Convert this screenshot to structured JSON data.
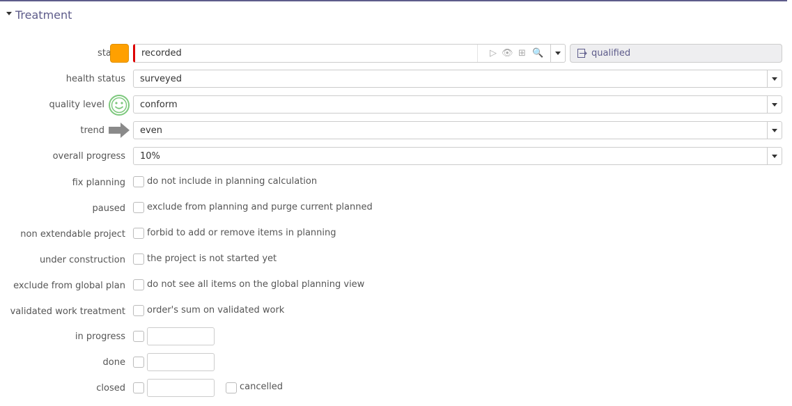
{
  "section": {
    "title": "Treatment"
  },
  "status": {
    "label": "status",
    "value": "recorded",
    "next_status": "qualified",
    "color": "#ffa000"
  },
  "health_status": {
    "label": "health status",
    "value": "surveyed"
  },
  "quality_level": {
    "label": "quality level",
    "value": "conform",
    "icon": "smiley-icon"
  },
  "trend": {
    "label": "trend",
    "value": "even",
    "icon": "arrow-right-icon"
  },
  "overall_progress": {
    "label": "overall progress",
    "value": "10%"
  },
  "fix_planning": {
    "label": "fix planning",
    "text": "do not include in planning calculation"
  },
  "paused": {
    "label": "paused",
    "text": "exclude from planning and purge current planned"
  },
  "non_extendable": {
    "label": "non extendable project",
    "text": "forbid to add or remove items in planning"
  },
  "under_construction": {
    "label": "under construction",
    "text": "the project is not started yet"
  },
  "exclude_global": {
    "label": "exclude from global plan",
    "text": "do not see all items on the global planning view"
  },
  "validated_work": {
    "label": "validated work treatment",
    "text": "order's sum on validated work"
  },
  "in_progress": {
    "label": "in progress",
    "date": ""
  },
  "done": {
    "label": "done",
    "date": ""
  },
  "closed": {
    "label": "closed",
    "date": "",
    "cancelled_label": "cancelled"
  }
}
